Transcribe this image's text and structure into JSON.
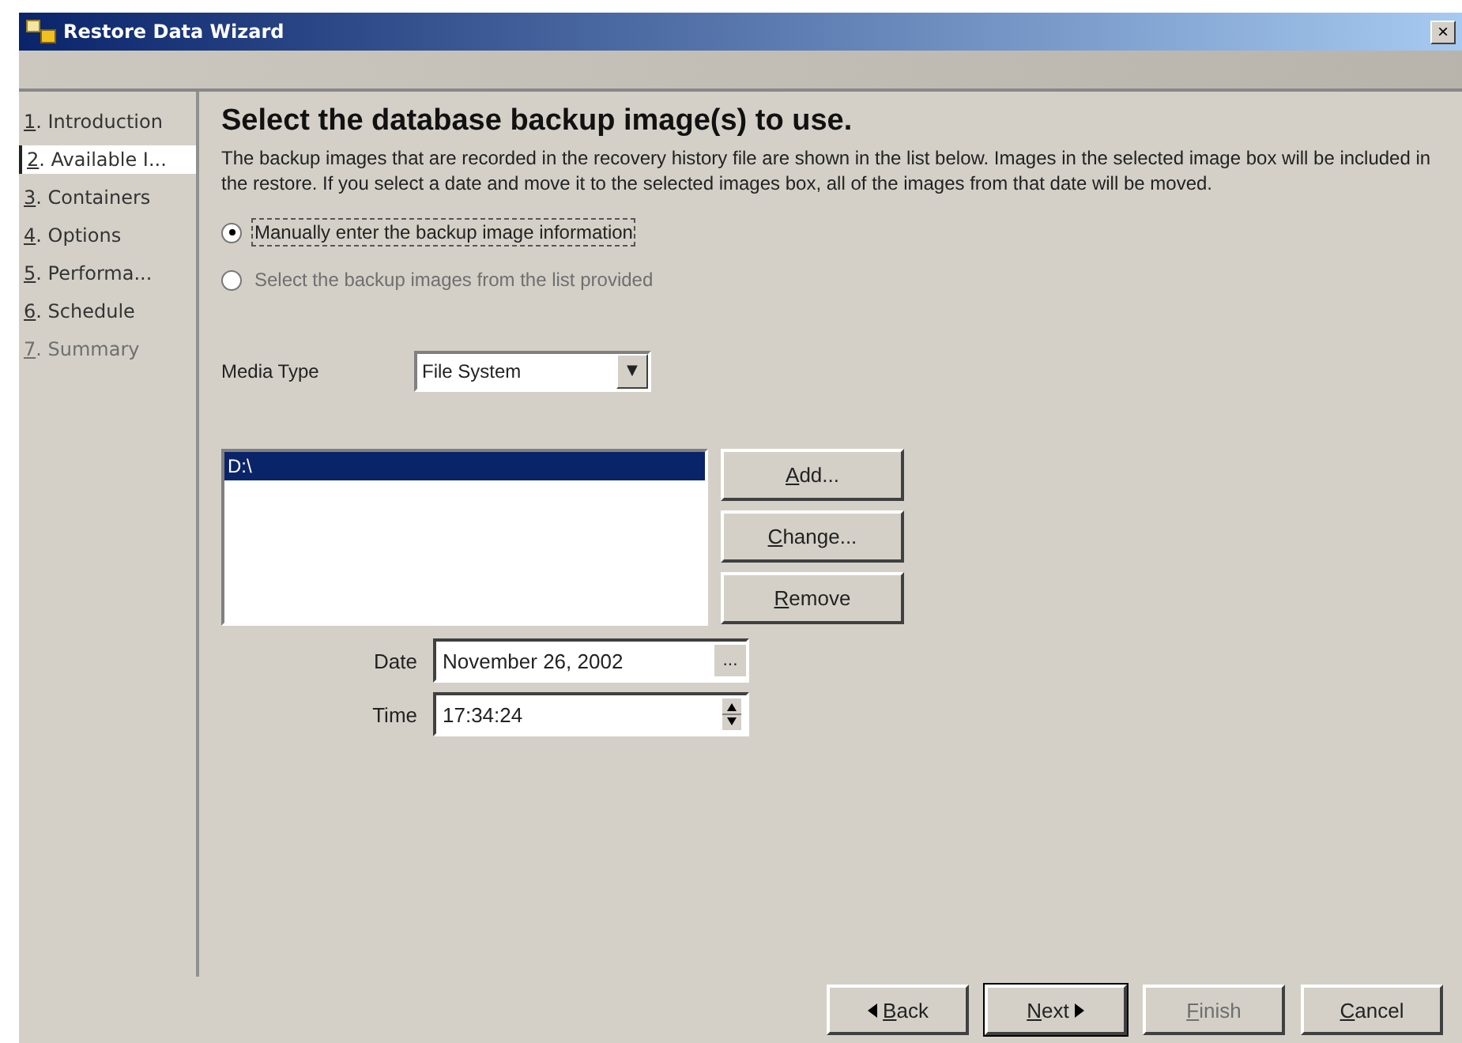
{
  "window": {
    "title": "Restore Data Wizard",
    "close": "×"
  },
  "steps": [
    {
      "num": "1",
      "label": ". Introduction",
      "selected": false,
      "disabled": false
    },
    {
      "num": "2",
      "label": ". Available I...",
      "selected": true,
      "disabled": false
    },
    {
      "num": "3",
      "label": ". Containers",
      "selected": false,
      "disabled": false
    },
    {
      "num": "4",
      "label": ". Options",
      "selected": false,
      "disabled": false
    },
    {
      "num": "5",
      "label": ". Performa...",
      "selected": false,
      "disabled": false
    },
    {
      "num": "6",
      "label": ". Schedule",
      "selected": false,
      "disabled": false
    },
    {
      "num": "7",
      "label": ". Summary",
      "selected": false,
      "disabled": true
    }
  ],
  "heading": "Select the database backup image(s) to use.",
  "description": "The backup images that are recorded in the recovery history file are shown in the list below. Images in the selected image box will be included in the restore. If you select a date and move it to the selected images box, all of the images from that date will be moved.",
  "options": [
    {
      "label": "Manually enter the backup image information",
      "selected": true,
      "disabled": false,
      "focused": true
    },
    {
      "label": "Select the backup images from the list provided",
      "selected": false,
      "disabled": true,
      "focused": false
    }
  ],
  "media_type": {
    "label": "Media Type",
    "value": "File System",
    "arrow": "▼"
  },
  "locations": [
    {
      "text": "D:\\",
      "selected": true
    }
  ],
  "location_buttons": [
    {
      "label": "Add...",
      "disabled": false
    },
    {
      "label": "Change...",
      "disabled": false
    },
    {
      "label": "Remove",
      "disabled": false
    }
  ],
  "date": {
    "label": "Date",
    "value": "November 26, 2002",
    "button": "..."
  },
  "time": {
    "label": "Time",
    "value": "17:34:24"
  },
  "buttons": [
    {
      "label": "Back",
      "kind": "back",
      "disabled": false,
      "default": false
    },
    {
      "label": "Next",
      "kind": "next",
      "disabled": false,
      "default": true
    },
    {
      "label": "Finish",
      "kind": "plain",
      "disabled": true,
      "default": false
    },
    {
      "label": "Cancel",
      "kind": "plain",
      "disabled": false,
      "default": false
    }
  ]
}
